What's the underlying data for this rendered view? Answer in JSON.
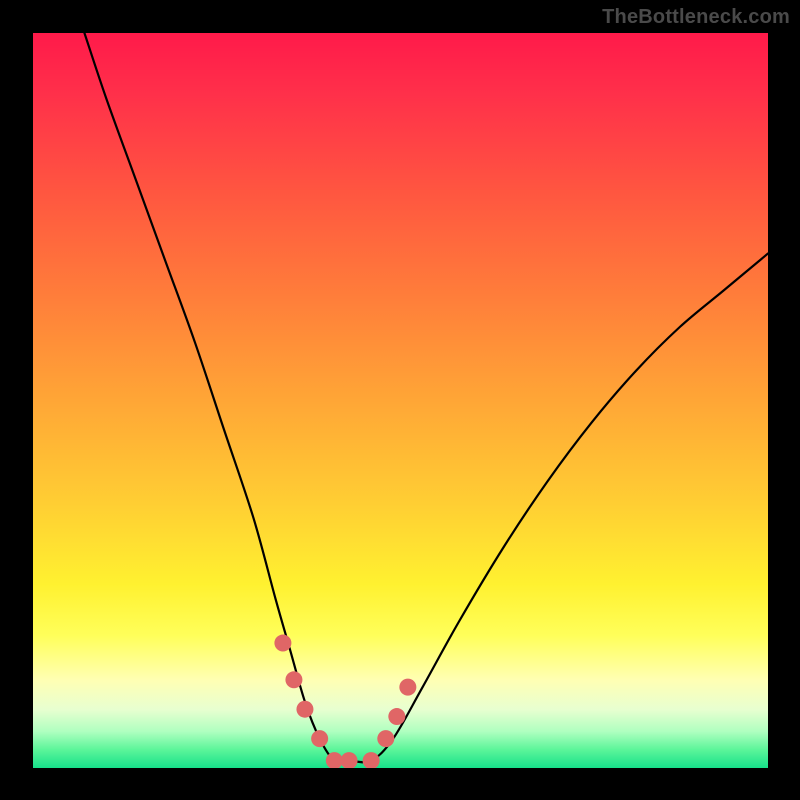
{
  "watermark": "TheBottleneck.com",
  "colors": {
    "frame": "#000000",
    "curve_stroke": "#000000",
    "marker_fill": "#e06666",
    "marker_stroke": "#c24f4f"
  },
  "chart_data": {
    "type": "line",
    "title": "",
    "xlabel": "",
    "ylabel": "",
    "x_range": [
      0,
      100
    ],
    "y_range": [
      0,
      100
    ],
    "grid": false,
    "legend": false,
    "series": [
      {
        "name": "bottleneck-curve",
        "x": [
          7,
          10,
          14,
          18,
          22,
          26,
          30,
          33,
          35,
          37,
          39,
          41,
          43,
          46,
          49,
          53,
          58,
          64,
          70,
          76,
          82,
          88,
          94,
          100
        ],
        "y": [
          100,
          91,
          80,
          69,
          58,
          46,
          34,
          23,
          16,
          9,
          4,
          1,
          1,
          1,
          4,
          11,
          20,
          30,
          39,
          47,
          54,
          60,
          65,
          70
        ]
      }
    ],
    "markers": {
      "name": "highlight-points",
      "x": [
        34,
        35.5,
        37,
        39,
        41,
        43,
        46,
        48,
        49.5,
        51
      ],
      "y": [
        17,
        12,
        8,
        4,
        1,
        1,
        1,
        4,
        7,
        11
      ]
    }
  }
}
